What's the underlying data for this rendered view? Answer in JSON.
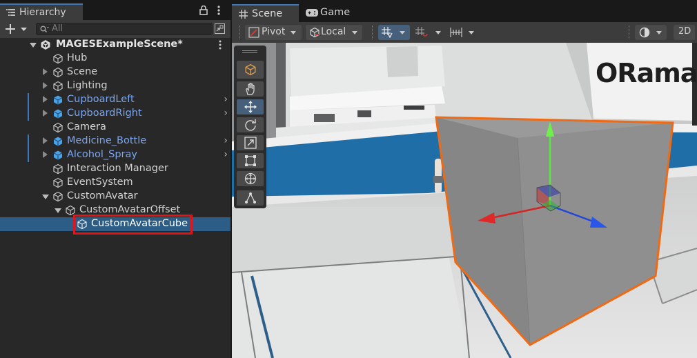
{
  "hierarchy": {
    "title": "Hierarchy",
    "search_placeholder": "All",
    "scene_root": "MAGESExampleScene*",
    "items": [
      {
        "label": "Hub",
        "prefab": false,
        "expander": false
      },
      {
        "label": "Scene",
        "prefab": false,
        "expander": true
      },
      {
        "label": "Lighting",
        "prefab": false,
        "expander": true
      },
      {
        "label": "CupboardLeft",
        "prefab": true,
        "expander": true
      },
      {
        "label": "CupboardRight",
        "prefab": true,
        "expander": true
      },
      {
        "label": "Camera",
        "prefab": false,
        "expander": false
      },
      {
        "label": "Medicine_Bottle",
        "prefab": true,
        "expander": true
      },
      {
        "label": "Alcohol_Spray",
        "prefab": true,
        "expander": true
      },
      {
        "label": "Interaction Manager",
        "prefab": false,
        "expander": false
      },
      {
        "label": "EventSystem",
        "prefab": false,
        "expander": false
      },
      {
        "label": "CustomAvatar",
        "prefab": false,
        "expander": true
      },
      {
        "label": "CustomAvatarOffset",
        "prefab": false,
        "expander": true
      },
      {
        "label": "CustomAvatarCube",
        "prefab": false,
        "expander": false
      }
    ],
    "highlight_color": "#e0161f",
    "selection_color": "#2c5d87",
    "prefab_color": "#7ba6ee"
  },
  "scene_view": {
    "tabs": [
      {
        "label": "Scene",
        "icon": "grid-icon"
      },
      {
        "label": "Game",
        "icon": "gamepad-icon"
      }
    ],
    "toolbar": {
      "pivot_label": "Pivot",
      "local_label": "Local",
      "mode_2d_label": "2D"
    },
    "tools": [
      "view-tool-icon",
      "hand-tool-icon",
      "move-tool-icon",
      "rotate-tool-icon",
      "scale-tool-icon",
      "rect-tool-icon",
      "transform-tool-icon",
      "custom-tool-icon"
    ],
    "wall_logo_text": "ORama",
    "selection_outline_color": "#f06a14"
  }
}
